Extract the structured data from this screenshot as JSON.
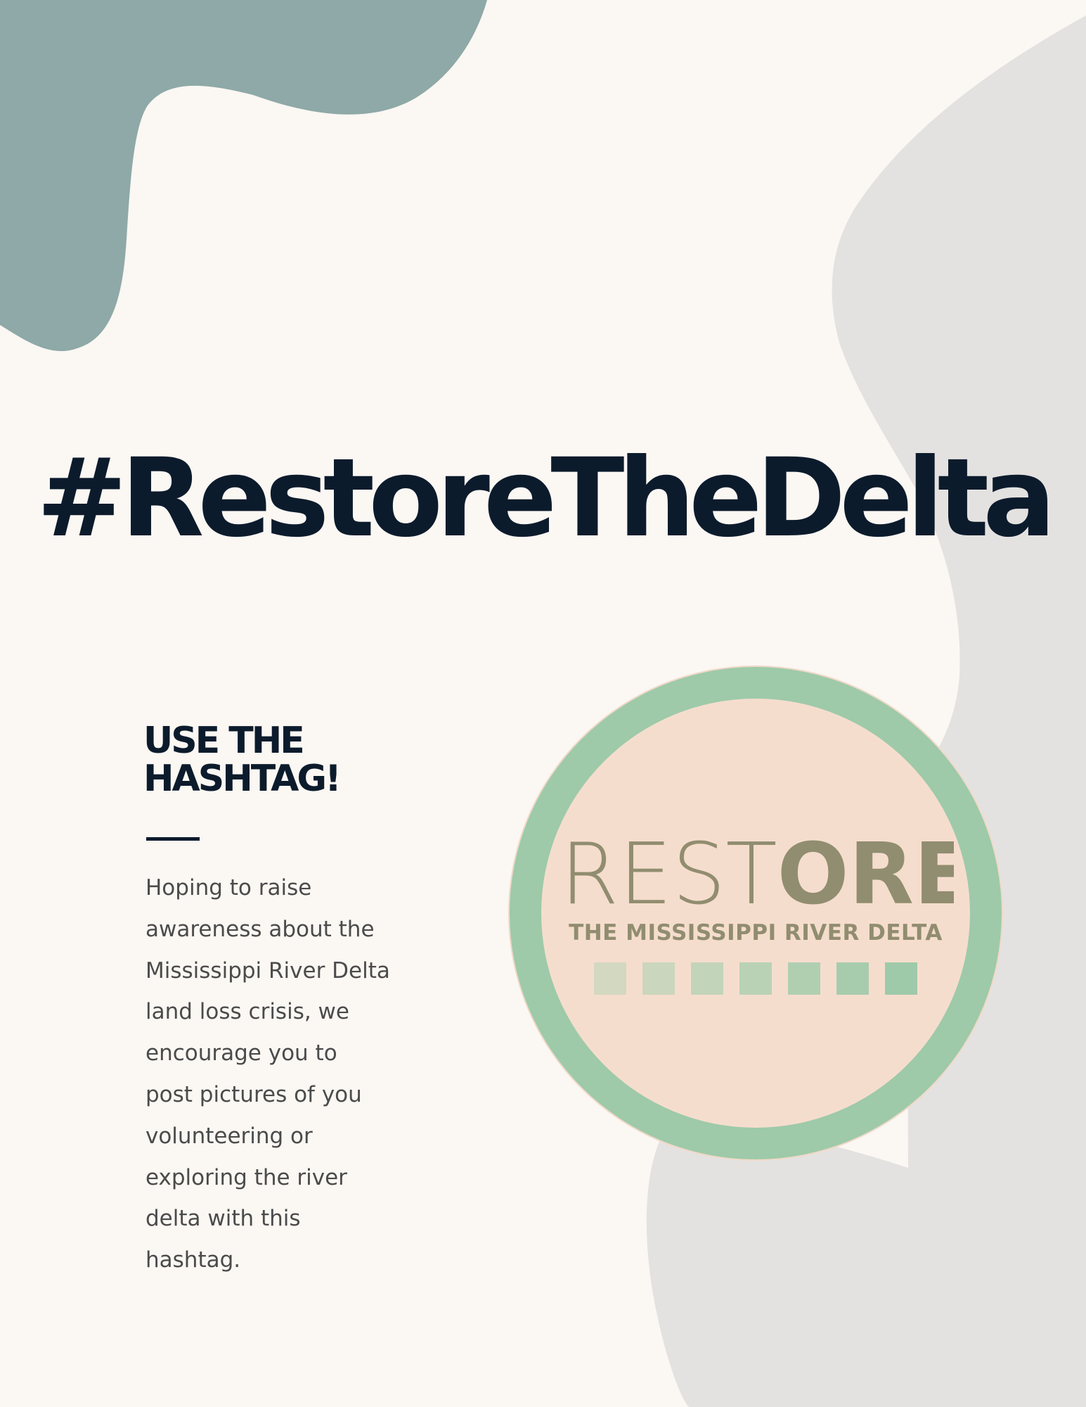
{
  "poster": {
    "title": "#RestoreTheDelta",
    "heading": "USE THE\nHASHTAG!",
    "body": "Hoping to raise\nawareness about the\nMississippi River Delta\nland loss crisis, we\nencourage you to\npost pictures of you\nvolunteering or\nexploring the river\ndelta with this\nhashtag."
  },
  "logo": {
    "word_light": "REST",
    "word_bold": "ORE",
    "subtitle": "THE MISSISSIPPI RIVER DELTA",
    "square_colors": [
      "#d3d8c0",
      "#cad6bd",
      "#c2d4b9",
      "#b9d2b5",
      "#b0cfb1",
      "#a7ccad",
      "#9ecaa9"
    ]
  },
  "colors": {
    "background": "#fbf7f3",
    "teal_blob": "#8ea9a7",
    "gray_blob": "#e4e2e0",
    "text_dark": "#0c1b2c",
    "text_body": "#4b4b4b",
    "logo_ring": "#9ecaa9",
    "logo_face": "#f5ddcd",
    "logo_text": "#918d70"
  }
}
